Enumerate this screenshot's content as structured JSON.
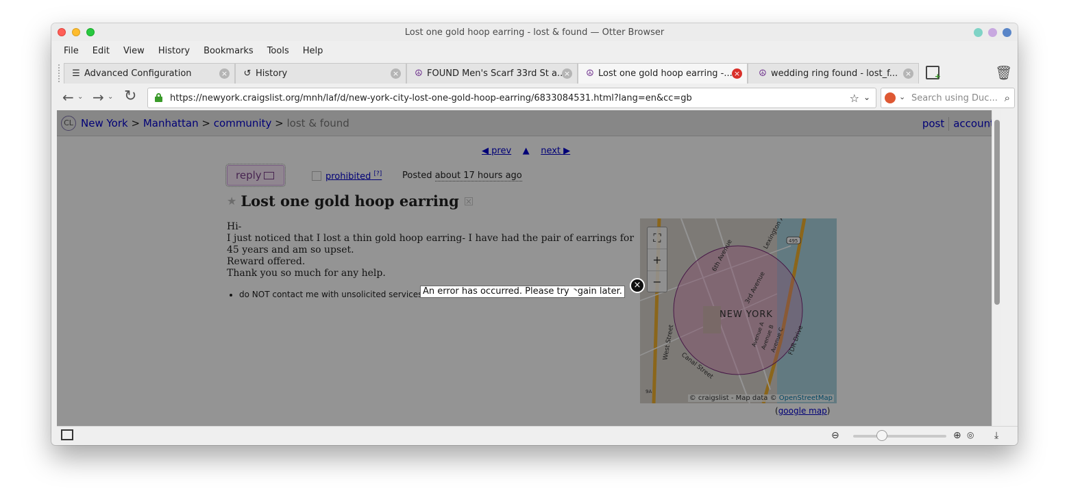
{
  "window": {
    "title": "Lost one gold hoop earring - lost & found — Otter Browser"
  },
  "menubar": [
    "File",
    "Edit",
    "View",
    "History",
    "Bookmarks",
    "Tools",
    "Help"
  ],
  "tabs": [
    {
      "label": "Advanced Configuration",
      "icon": "settings-icon",
      "active": false
    },
    {
      "label": "History",
      "icon": "history-icon",
      "active": false
    },
    {
      "label": "FOUND Men's Scarf 33rd St a...",
      "icon": "peace-icon",
      "active": false
    },
    {
      "label": "Lost one gold hoop earring -...",
      "icon": "peace-icon",
      "active": true
    },
    {
      "label": "wedding ring found - lost_f...",
      "icon": "peace-icon",
      "active": false
    }
  ],
  "toolbar": {
    "url": "https://newyork.craigslist.org/mnh/laf/d/new-york-city-lost-one-gold-hoop-earring/6833084531.html?lang=en&cc=gb",
    "search_placeholder": "Search using Duc..."
  },
  "page": {
    "logo": "CL",
    "breadcrumbs": [
      "New York",
      ">",
      "Manhattan",
      ">",
      "community",
      ">",
      "lost & found"
    ],
    "header_links": {
      "post": "post",
      "account": "account"
    },
    "prev": "◀ prev",
    "up": "▲",
    "next": "next ▶",
    "reply": "reply",
    "prohibited": "prohibited",
    "prohibited_sup": "[?]",
    "posted_label": "Posted",
    "posted_ago": "about 17 hours ago",
    "title": "Lost one gold hoop earring",
    "body": [
      "Hi-",
      "I just noticed that I lost a thin gold hoop earring- I have had the pair of earrings for 45 years and am so upset.",
      "Reward offered.",
      "Thank you so much for any help."
    ],
    "notice": "do NOT contact me with unsolicited services or offers",
    "map": {
      "label": "NEW YORK",
      "attribution": "© craigslist - Map data ©",
      "osm": "OpenStreetMap",
      "streets": [
        "West Street",
        "Canal Street",
        "6th Avenue",
        "3rd Avenue",
        "Lexington Avenue",
        "Avenue A",
        "Avenue B",
        "Avenue C",
        "FDR Drive"
      ],
      "route_badges": [
        "495",
        "9A"
      ]
    },
    "google_map": {
      "open": "(",
      "label": "google map",
      "close": ")"
    }
  },
  "error": {
    "message": "An error has occurred. Please try again later."
  },
  "colors": {
    "link": "#0000cc",
    "active_tab_close": "#d9302a",
    "reply_bg": "#f8e7f8",
    "reply_text": "#7a3f8a"
  }
}
